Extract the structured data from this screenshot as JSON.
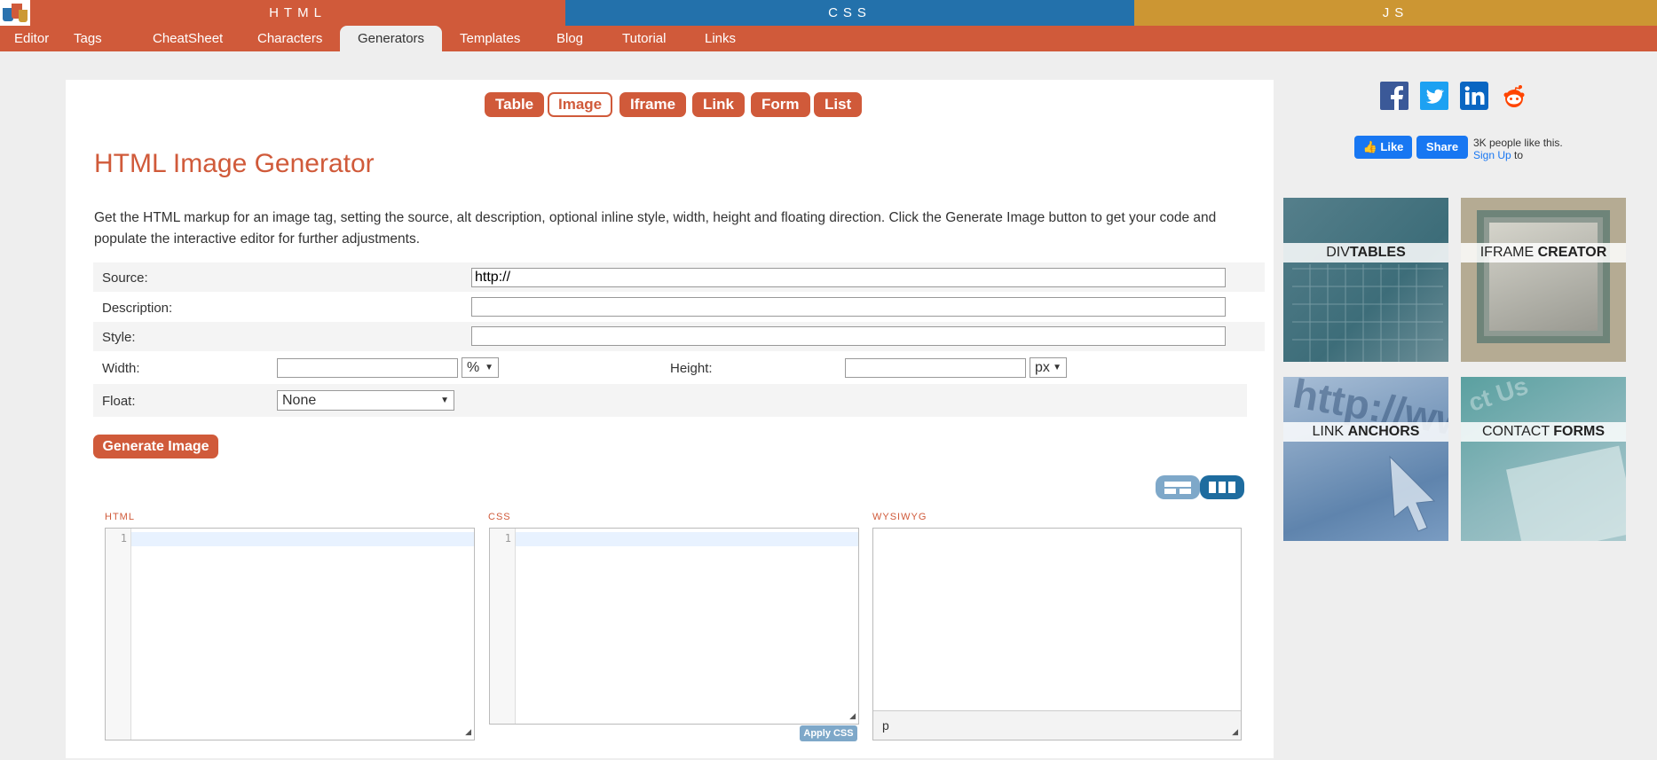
{
  "top_strip": {
    "html": "HTML",
    "css": "CSS",
    "js": "JS"
  },
  "nav": [
    "Editor",
    "Tags",
    "CheatSheet",
    "Characters",
    "Generators",
    "Templates",
    "Blog",
    "Tutorial",
    "Links"
  ],
  "nav_active": "Generators",
  "gen_tabs": [
    "Table",
    "Image",
    "Iframe",
    "Link",
    "Form",
    "List"
  ],
  "gen_active": "Image",
  "page_title": "HTML Image Generator",
  "description": "Get the HTML markup for an image tag, setting the source, alt description, optional inline style, width, height and floating direction. Click the Generate Image button to get your code and populate the interactive editor for further adjustments.",
  "form": {
    "source_label": "Source:",
    "source_value": "http://",
    "description_label": "Description:",
    "style_label": "Style:",
    "width_label": "Width:",
    "width_unit": "%",
    "height_label": "Height:",
    "height_unit": "px",
    "float_label": "Float:",
    "float_value": "None"
  },
  "generate_button": "Generate Image",
  "panes": {
    "html_label": "HTML",
    "css_label": "CSS",
    "wysiwyg_label": "WYSIWYG",
    "line_number": "1",
    "apply_css": "Apply CSS",
    "wysiwyg_status": "p"
  },
  "facebook": {
    "like": "Like",
    "share": "Share",
    "text_prefix": "3K people like this.",
    "sign_up": "Sign Up",
    "text_suffix": "to"
  },
  "tiles": [
    {
      "light": "DIV",
      "bold": "TABLES"
    },
    {
      "light": "IFRAME",
      "bold": "CREATOR"
    },
    {
      "light": "LINK",
      "bold": "ANCHORS"
    },
    {
      "light": "CONTACT",
      "bold": "FORMS"
    }
  ],
  "colors": {
    "html": "#d05a3a",
    "css": "#2371ab",
    "js": "#cc9633",
    "facebook": "#1877f2",
    "twitter": "#1da1f2",
    "linkedin": "#0a66c2",
    "reddit": "#ff4500"
  }
}
